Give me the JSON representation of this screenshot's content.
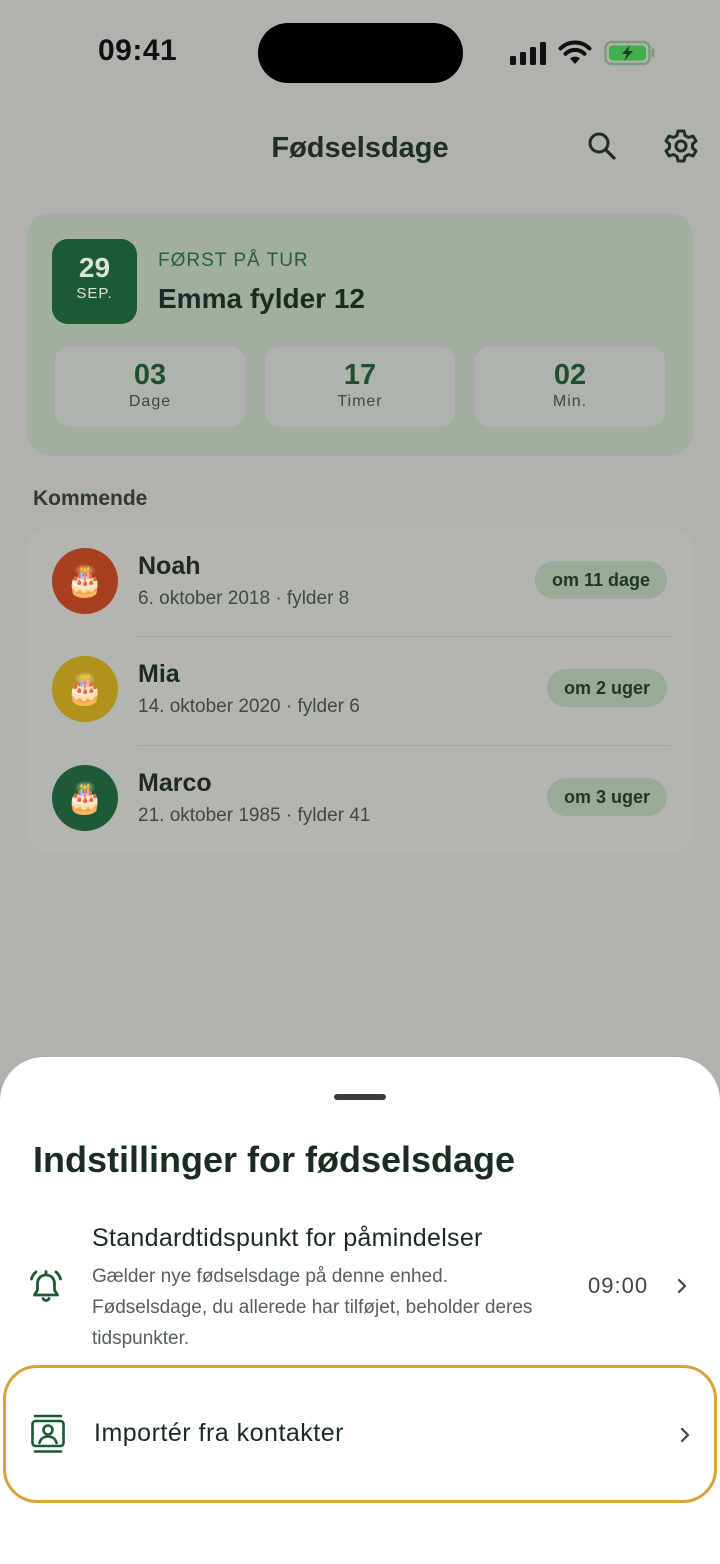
{
  "status_bar": {
    "time": "09:41"
  },
  "header": {
    "title": "Fødselsdage"
  },
  "hero": {
    "date_day": "29",
    "date_month": "SEP.",
    "kicker": "FØRST PÅ TUR",
    "name": "Emma fylder 12",
    "countdown": [
      {
        "value": "03",
        "label": "Dage"
      },
      {
        "value": "17",
        "label": "Timer"
      },
      {
        "value": "02",
        "label": "Min."
      }
    ]
  },
  "upcoming": {
    "title": "Kommende",
    "items": [
      {
        "name": "Noah",
        "subtitle": "6. oktober 2018 · fylder 8",
        "badge": "om 11 dage",
        "avatar_color": "#a8401f"
      },
      {
        "name": "Mia",
        "subtitle": "14. oktober 2020 · fylder 6",
        "badge": "om 2 uger",
        "avatar_color": "#b0921c"
      },
      {
        "name": "Marco",
        "subtitle": "21. oktober 1985 · fylder 41",
        "badge": "om 3 uger",
        "avatar_color": "#1d5a35"
      }
    ]
  },
  "sheet": {
    "title": "Indstillinger for fødselsdage",
    "reminder": {
      "title": "Standardtidspunkt for påmindelser",
      "description": "Gælder nye fødselsdage på denne enhed. Fødselsdage, du allerede har tilføjet, beholder deres tidspunkter.",
      "value": "09:00"
    },
    "import": {
      "label": "Importér fra kontakter"
    }
  },
  "colors": {
    "accent": "#1c5a36",
    "highlight": "#d9a23a",
    "scrim": "#b1b1ae"
  },
  "icons": [
    "search-icon",
    "gear-icon",
    "bell-icon",
    "contacts-icon",
    "chevron-right-icon",
    "cake-icon"
  ]
}
